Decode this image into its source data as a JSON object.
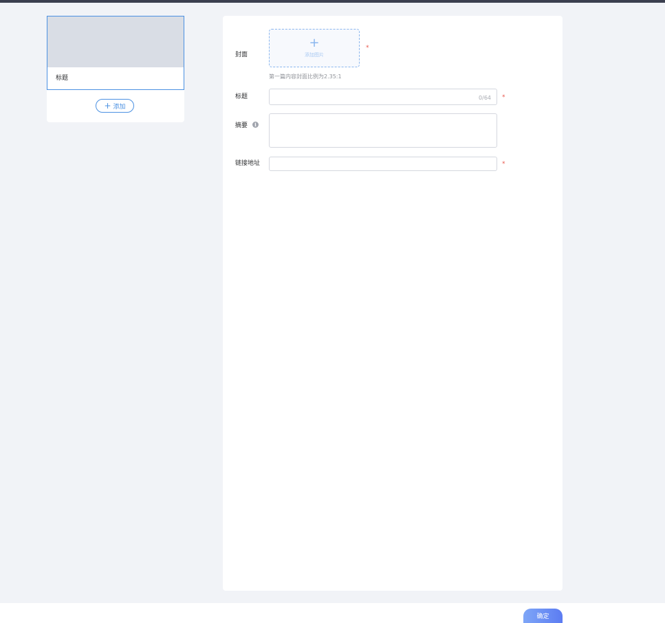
{
  "articles": [
    {
      "title": "标题"
    }
  ],
  "add_button": {
    "label": "添加"
  },
  "form": {
    "cover": {
      "label": "封面",
      "upload_text": "添加图片",
      "hint": "第一篇内容封面比例为2.35:1",
      "required_mark": "*"
    },
    "title": {
      "label": "标题",
      "value": "",
      "char_count": "0/64",
      "required_mark": "*"
    },
    "summary": {
      "label": "摘要",
      "value": ""
    },
    "link": {
      "label": "链接地址",
      "value": "",
      "required_mark": "*"
    }
  },
  "footer": {
    "confirm_label": "确定"
  },
  "colors": {
    "accent": "#4a90e2",
    "required": "#e8564c",
    "confirm_gradient_start": "#7ea6f7",
    "confirm_gradient_end": "#5c7cf2"
  }
}
